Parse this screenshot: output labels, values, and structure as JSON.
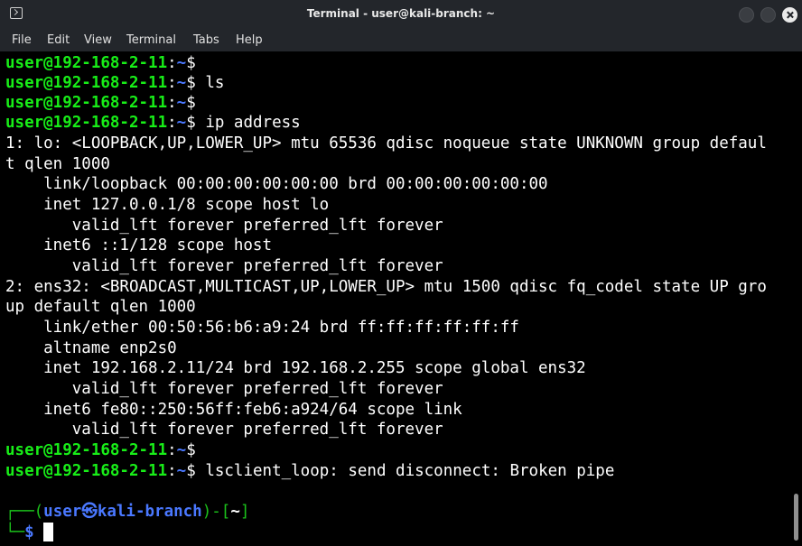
{
  "window": {
    "title": "Terminal - user@kali-branch: ~"
  },
  "menu": [
    "File",
    "Edit",
    "View",
    "Terminal",
    "Tabs",
    "Help"
  ],
  "prompt": {
    "user_host": "user@192-168-2-11",
    "sep": ":",
    "path": "~",
    "dollar": "$"
  },
  "commands": [
    "",
    "ls",
    "",
    "ip address",
    "",
    "lsclient_loop: send disconnect: Broken pipe"
  ],
  "output": [
    "1: lo: <LOOPBACK,UP,LOWER_UP> mtu 65536 qdisc noqueue state UNKNOWN group defaul",
    "t qlen 1000",
    "    link/loopback 00:00:00:00:00:00 brd 00:00:00:00:00:00",
    "    inet 127.0.0.1/8 scope host lo",
    "       valid_lft forever preferred_lft forever",
    "    inet6 ::1/128 scope host",
    "       valid_lft forever preferred_lft forever",
    "2: ens32: <BROADCAST,MULTICAST,UP,LOWER_UP> mtu 1500 qdisc fq_codel state UP gro",
    "up default qlen 1000",
    "    link/ether 00:50:56:b6:a9:24 brd ff:ff:ff:ff:ff:ff",
    "    altname enp2s0",
    "    inet 192.168.2.11/24 brd 192.168.2.255 scope global ens32",
    "       valid_lft forever preferred_lft forever",
    "    inet6 fe80::250:56ff:feb6:a924/64 scope link",
    "       valid_lft forever preferred_lft forever"
  ],
  "kali_prompt": {
    "open": "┌──(",
    "user": "user",
    "skull": "㉿",
    "host": "kali-branch",
    "mid": ")-[",
    "path": "~",
    "close": "]",
    "line2": "└─",
    "dollar": "$"
  },
  "colors": {
    "user_green": "#18ee18",
    "path_blue": "#4a78ff",
    "kali_green": "#1bc21b",
    "background": "#000000",
    "titlebar": "#23262b"
  }
}
